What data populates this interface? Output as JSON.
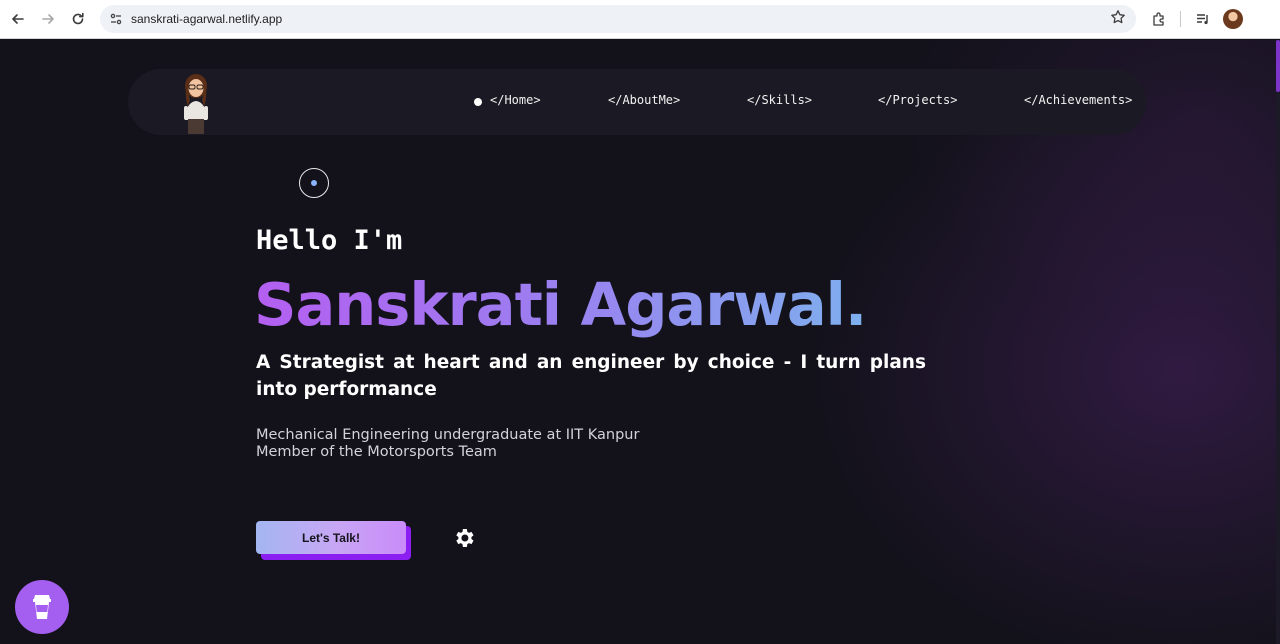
{
  "browser": {
    "url": "sanskrati-agarwal.netlify.app",
    "icons": [
      "back-arrow-icon",
      "forward-arrow-icon",
      "reload-icon",
      "site-info-icon",
      "star-icon",
      "extensions-icon",
      "media-control-icon",
      "profile-avatar"
    ]
  },
  "nav": {
    "links": [
      "</Home>",
      "</AboutMe>",
      "</Skills>",
      "</Projects>",
      "</Achievements>"
    ]
  },
  "hero": {
    "greeting": "Hello I'm",
    "name": "Sanskrati Agarwal.",
    "tagline": "A Strategist at heart and an engineer by choice - I turn plans into performance",
    "desc_line1": "Mechanical Engineering undergraduate at IIT Kanpur",
    "desc_line2": "Member of the Motorsports Team",
    "cta_label": "Let's Talk!"
  },
  "colors": {
    "background": "#13121b",
    "navbar": "#1b1a24",
    "name_gradient_start": "#b45ff0",
    "name_gradient_end": "#7eb0ee",
    "accent_purple": "#a45ef0"
  }
}
